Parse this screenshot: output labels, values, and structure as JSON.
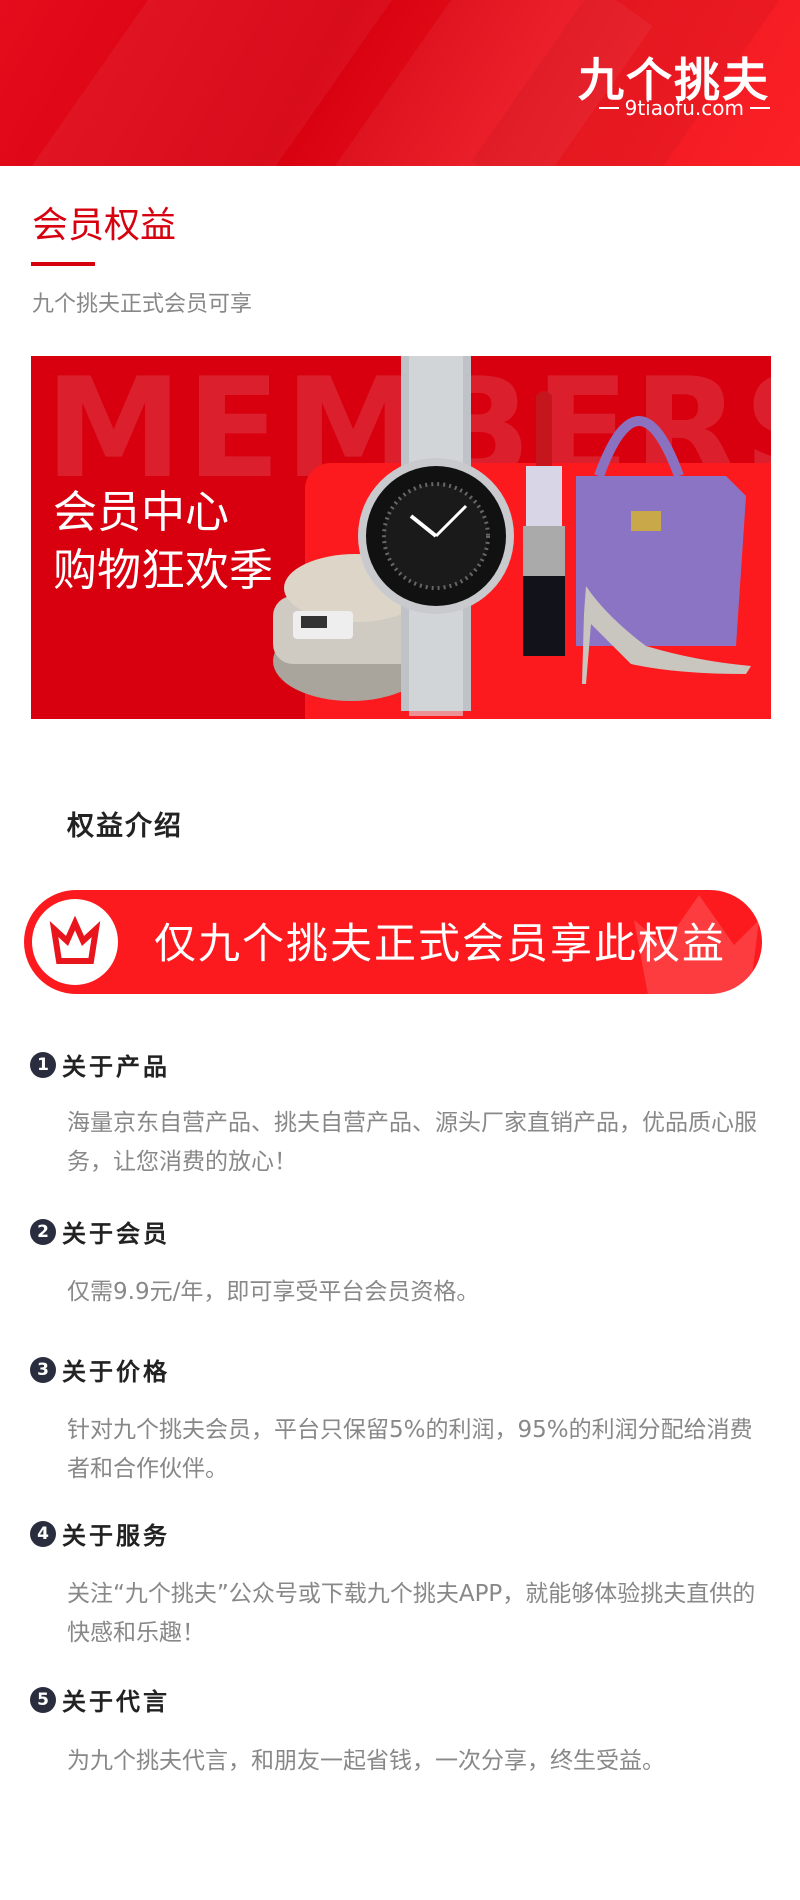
{
  "header": {
    "logo_text": "九个挑夫",
    "logo_domain": "9tiaofu.com"
  },
  "page": {
    "title": "会员权益",
    "subtitle": "九个挑夫正式会员可享",
    "accent": "#d7000f"
  },
  "banner": {
    "watermark": "MEMBERSHIP",
    "line1": "会员中心",
    "line2": "购物狂欢季",
    "products": [
      "rice-cooker",
      "watch",
      "lipstick",
      "handbag",
      "high-heel"
    ]
  },
  "section": {
    "heading": "权益介绍"
  },
  "pill": {
    "text": "仅九个挑夫正式会员享此权益",
    "icon": "crown-icon"
  },
  "items": [
    {
      "num": "1",
      "title": "关于产品",
      "body": "海量京东自营产品、挑夫自营产品、源头厂家直销产品，优品质心服务，让您消费的放心！"
    },
    {
      "num": "2",
      "title": "关于会员",
      "body": "仅需9.9元/年，即可享受平台会员资格。"
    },
    {
      "num": "3",
      "title": "关于价格",
      "body": "针对九个挑夫会员，平台只保留5%的利润，95%的利润分配给消费者和合作伙伴。"
    },
    {
      "num": "4",
      "title": "关于服务",
      "body": "关注“九个挑夫”公众号或下载九个挑夫APP，就能够体验挑夫直供的快感和乐趣！"
    },
    {
      "num": "5",
      "title": "关于代言",
      "body": "为九个挑夫代言，和朋友一起省钱，一次分享，终生受益。"
    }
  ]
}
